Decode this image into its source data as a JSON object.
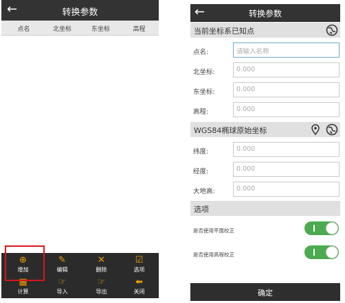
{
  "left_screen": {
    "header": {
      "back_icon": "arrow-left-icon",
      "title": "转换参数"
    },
    "columns": [
      "点名",
      "北坐标",
      "东坐标",
      "高程"
    ],
    "toolbar": [
      {
        "label": "增加",
        "icon": "plus-circle-icon",
        "glyph": "⊕"
      },
      {
        "label": "编辑",
        "icon": "edit-icon",
        "glyph": "✎"
      },
      {
        "label": "删除",
        "icon": "delete-x-icon",
        "glyph": "✕"
      },
      {
        "label": "选项",
        "icon": "checkbox-icon",
        "glyph": "☑"
      },
      {
        "label": "计算",
        "icon": "calculator-icon",
        "glyph": "▦"
      },
      {
        "label": "导入",
        "icon": "import-icon",
        "glyph": "☞"
      },
      {
        "label": "导出",
        "icon": "export-icon",
        "glyph": "☞"
      },
      {
        "label": "关闭",
        "icon": "close-arrow-icon",
        "glyph": "⬅"
      }
    ],
    "highlight_color": "#d9161b"
  },
  "right_screen": {
    "header": {
      "back_icon": "arrow-left-icon",
      "title": "转换参数"
    },
    "section_local": {
      "title": "当前坐标系已知点",
      "icon": "globe-icon"
    },
    "point_name": {
      "label": "点名:",
      "placeholder": "请输入名称"
    },
    "north": {
      "label": "北坐标:",
      "value": "0.000"
    },
    "east": {
      "label": "东坐标:",
      "value": "0.000"
    },
    "elevation": {
      "label": "高程:",
      "value": "0.000"
    },
    "section_wgs": {
      "title": "WGS84椭球原始坐标",
      "icons": [
        "location-pin-icon",
        "globe-icon"
      ]
    },
    "latitude": {
      "label": "纬度:",
      "value": "0.000"
    },
    "longitude": {
      "label": "经度:",
      "value": "0.000"
    },
    "geodetic_height": {
      "label": "大地高:",
      "value": "0.000"
    },
    "section_options": {
      "title": "选项"
    },
    "plane_correction": {
      "label": "是否使用平面校正",
      "on": true
    },
    "elevation_correction": {
      "label": "是否使用高程校正",
      "on": true
    },
    "confirm_label": "确定",
    "accent_green": "#4caa4f"
  }
}
